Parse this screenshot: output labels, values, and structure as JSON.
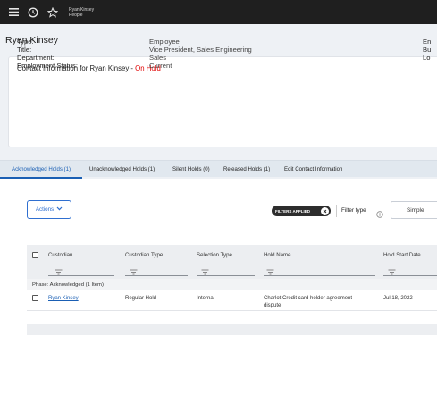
{
  "topbar": {
    "user_name": "Ryan Kinsey",
    "section": "People"
  },
  "page_title": "Ryan Kinsey",
  "contact_card": {
    "heading_prefix": "Contact Information for Ryan Kinsey - ",
    "status": "On Hold",
    "labels": [
      "Type:",
      "Title:",
      "Department:",
      "Employment Status:"
    ],
    "values": [
      "Employee",
      "Vice President, Sales Engineering",
      "Sales",
      "Current"
    ],
    "right_labels_partial": [
      "En",
      "Bu",
      "Lo"
    ]
  },
  "tabs": [
    {
      "label": "Acknowledged Holds (1)",
      "active": true
    },
    {
      "label": "Unacknowledged Holds (1)",
      "active": false
    },
    {
      "label": "Silent Holds (0)",
      "active": false
    },
    {
      "label": "Released Holds (1)",
      "active": false
    },
    {
      "label": "Edit Contact Information",
      "active": false
    }
  ],
  "toolbar": {
    "actions_label": "Actions",
    "filters_applied_label": "FILTERS APPLIED",
    "filter_type_label": "Filter type",
    "filter_type_value": "Simple"
  },
  "table": {
    "columns": [
      "Custodian",
      "Custodian Type",
      "Selection Type",
      "Hold Name",
      "Hold Start Date"
    ],
    "phase_label": "Phase: Acknowledged",
    "phase_count": "(1 Item)",
    "rows": [
      {
        "custodian": "Ryan Kinsey",
        "custodian_type": "Regular Hold",
        "selection_type": "Internal",
        "hold_name_line1": "Charlot Credit card holder agreement",
        "hold_name_line2": "dispute",
        "hold_start_date": "Jul 18, 2022"
      }
    ]
  },
  "colors": {
    "accent": "#1a5fb4",
    "status_on_hold": "#e00000",
    "topbar": "#1f1f1f"
  },
  "icons": [
    "menu-icon",
    "clock-icon",
    "star-icon",
    "chevron-down-icon",
    "close-icon",
    "info-icon",
    "filter-icon"
  ]
}
